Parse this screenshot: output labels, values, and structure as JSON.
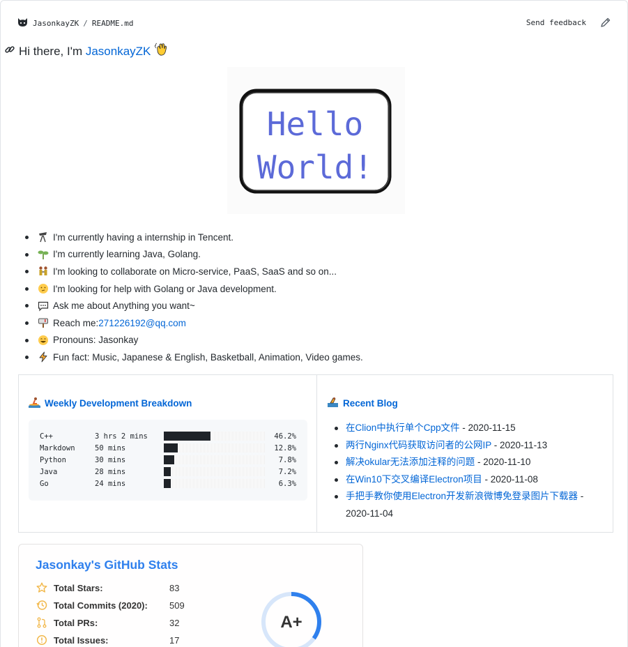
{
  "breadcrumb": {
    "repo_owner": "JasonkayZK",
    "separator": "/",
    "file": "README.md"
  },
  "toolbar": {
    "feedback_label": "Send feedback",
    "edit_icon": "pencil-icon"
  },
  "heading": {
    "prefix": "Hi there, I'm ",
    "name": "JasonkayZK",
    "emoji": "waving-hand"
  },
  "banner": {
    "line1": "Hello",
    "line2": "World!"
  },
  "about": [
    {
      "icon": "telescope",
      "text": "I'm currently having a internship in Tencent."
    },
    {
      "icon": "seedling",
      "text": "I'm currently learning Java, Golang."
    },
    {
      "icon": "people-holding-hands",
      "text": "I'm looking to collaborate on Micro-service, PaaS, SaaS and so on..."
    },
    {
      "icon": "thinking-face",
      "text": "I'm looking for help with Golang or Java development."
    },
    {
      "icon": "speech-balloon",
      "text": "Ask me about Anything you want~"
    },
    {
      "icon": "mailbox",
      "text": "Reach me: ",
      "link": "271226192@qq.com"
    },
    {
      "icon": "grinning-face",
      "text": "Pronouns: Jasonkay"
    },
    {
      "icon": "high-voltage",
      "text": "Fun fact: Music, Japanese & English, Basketball, Animation, Video games."
    }
  ],
  "weekly": {
    "title": "Weekly Development Breakdown",
    "rows": [
      {
        "lang": "C++",
        "time": "3 hrs 2 mins",
        "pct": "46.2%",
        "fill": 0.46
      },
      {
        "lang": "Markdown",
        "time": "50 mins",
        "pct": "12.8%",
        "fill": 0.14
      },
      {
        "lang": "Python",
        "time": "30 mins",
        "pct": "7.8%",
        "fill": 0.1
      },
      {
        "lang": "Java",
        "time": "28 mins",
        "pct": "7.2%",
        "fill": 0.07
      },
      {
        "lang": "Go",
        "time": "24 mins",
        "pct": "6.3%",
        "fill": 0.07
      }
    ]
  },
  "blog": {
    "title": "Recent Blog",
    "posts": [
      {
        "title": "在Clion中执行单个Cpp文件",
        "date": " - 2020-11-15"
      },
      {
        "title": "两行Nginx代码获取访问者的公网IP",
        "date": " - 2020-11-13"
      },
      {
        "title": "解决okular无法添加注释的问题",
        "date": " - 2020-11-10"
      },
      {
        "title": "在Win10下交叉编译Electron项目",
        "date": " - 2020-11-08"
      },
      {
        "title": "手把手教你使用Electron开发新浪微博免登录图片下载器",
        "date": " - 2020-11-04"
      }
    ]
  },
  "stats": {
    "title": "Jasonkay's GitHub Stats",
    "rows": [
      {
        "label": "Total Stars:",
        "value": "83",
        "icon": "star-icon"
      },
      {
        "label": "Total Commits (2020):",
        "value": "509",
        "icon": "history-icon"
      },
      {
        "label": "Total PRs:",
        "value": "32",
        "icon": "pull-request-icon"
      },
      {
        "label": "Total Issues:",
        "value": "17",
        "icon": "issue-icon"
      }
    ],
    "rank": "A+",
    "rank_progress": 0.35
  },
  "colors": {
    "link": "#0366d6",
    "stats_title": "#2f80ed",
    "stats_icon": "#4c71f2",
    "rank_ring": "#2f80ed"
  }
}
